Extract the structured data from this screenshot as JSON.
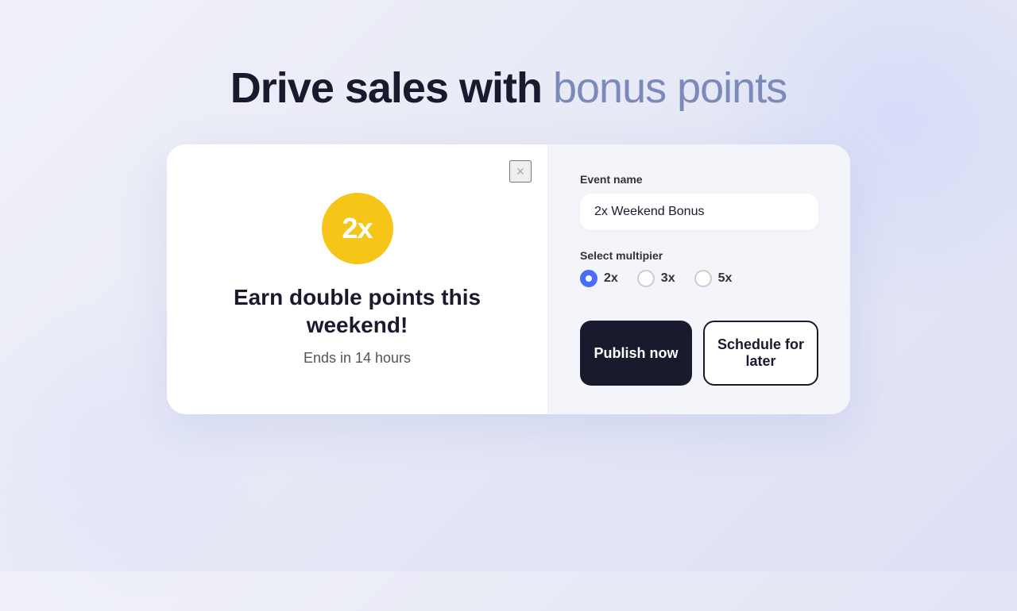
{
  "page": {
    "title_bold": "Drive sales with",
    "title_light": " bonus points"
  },
  "preview": {
    "badge_text": "2x",
    "headline": "Earn double points this weekend!",
    "subtext": "Ends in 14 hours",
    "close_icon": "×"
  },
  "settings": {
    "event_name_label": "Event name",
    "event_name_value": "2x Weekend Bonus",
    "event_name_placeholder": "2x Weekend Bonus",
    "multiplier_label": "Select multipier",
    "multiplier_options": [
      {
        "value": "2x",
        "selected": true
      },
      {
        "value": "3x",
        "selected": false
      },
      {
        "value": "5x",
        "selected": false
      }
    ],
    "publish_now_label": "Publish now",
    "schedule_later_label": "Schedule for later"
  },
  "colors": {
    "badge_bg": "#f5c518",
    "primary_btn_bg": "#1a1a2e",
    "radio_selected": "#4a6cf7"
  }
}
